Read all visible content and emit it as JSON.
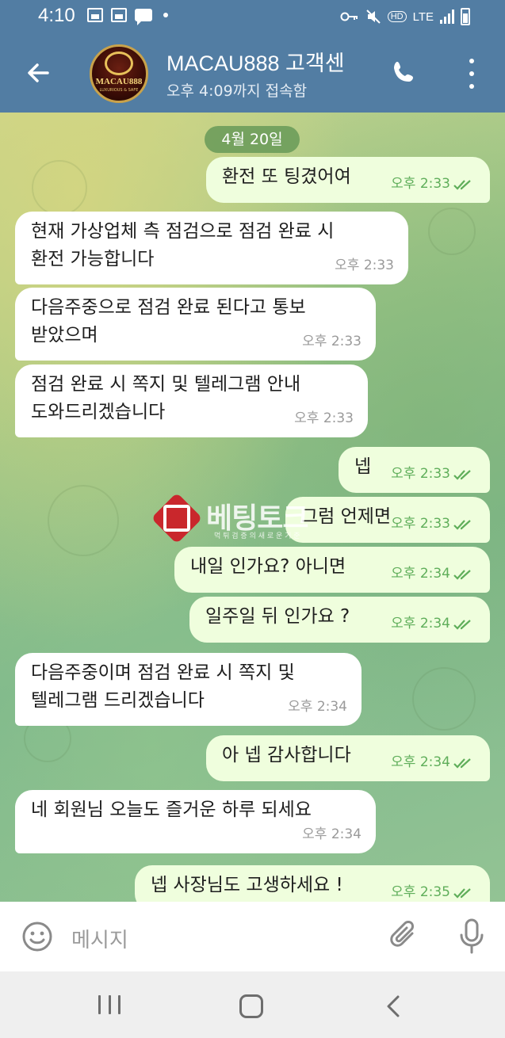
{
  "status_bar": {
    "time": "4:10",
    "network": "LTE",
    "hd_label": "HD"
  },
  "header": {
    "title": "MACAU888 고객센",
    "subtitle": "오후 4:09까지 접속함",
    "avatar_text": "MACAU888",
    "avatar_subtext": "LUXURIOUS & SAFE"
  },
  "chat": {
    "date_chip": "4월 20일",
    "messages": [
      {
        "dir": "out",
        "lines": [
          "환전 또 팅겼어여"
        ],
        "time": "오후 2:33",
        "read": true
      },
      {
        "dir": "in",
        "lines": [
          "현재 가상업체 측 점검으로 점검 완료 시",
          "환전 가능합니다"
        ],
        "time": "오후 2:33"
      },
      {
        "dir": "in",
        "lines": [
          "다음주중으로 점검 완료 된다고 통보",
          "받았으며"
        ],
        "time": "오후 2:33"
      },
      {
        "dir": "in",
        "lines": [
          "점검 완료 시 쪽지 및 텔레그램 안내",
          "도와드리겠습니다"
        ],
        "time": "오후 2:33"
      },
      {
        "dir": "out",
        "lines": [
          "넵"
        ],
        "time": "오후 2:33",
        "read": true
      },
      {
        "dir": "out",
        "lines": [
          "그럼 언제면"
        ],
        "time": "오후 2:33",
        "read": true
      },
      {
        "dir": "out",
        "lines": [
          "내일 인가요? 아니면"
        ],
        "time": "오후 2:34",
        "read": true
      },
      {
        "dir": "out",
        "lines": [
          "일주일 뒤 인가요 ?"
        ],
        "time": "오후 2:34",
        "read": true
      },
      {
        "dir": "in",
        "lines": [
          "다음주중이며 점검 완료 시 쪽지 및",
          "텔레그램 드리겠습니다"
        ],
        "time": "오후 2:34"
      },
      {
        "dir": "out",
        "lines": [
          "아 넵 감사합니다"
        ],
        "time": "오후 2:34",
        "read": true
      },
      {
        "dir": "in",
        "lines": [
          "네 회원님 오늘도 즐거운 하루 되세요"
        ],
        "time": "오후 2:34"
      },
      {
        "dir": "out",
        "lines": [
          "넵 사장님도 고생하세요 !"
        ],
        "time": "오후 2:35",
        "read": true
      }
    ]
  },
  "watermark": {
    "text": "베팅토크",
    "subtext": "먹 튀 검 증 의   새 로 운 기 준"
  },
  "input": {
    "placeholder": "메시지"
  },
  "icons": {
    "back": "arrow-left-icon",
    "call": "phone-icon",
    "menu": "more-vert-icon",
    "emoji": "smiley-icon",
    "attach": "paperclip-icon",
    "voice": "microphone-icon"
  },
  "colors": {
    "header": "#527da3",
    "incoming_bubble": "#ffffff",
    "outgoing_bubble": "#effedd",
    "time_outgoing": "#5fae5a",
    "date_chip": "#679a58"
  }
}
